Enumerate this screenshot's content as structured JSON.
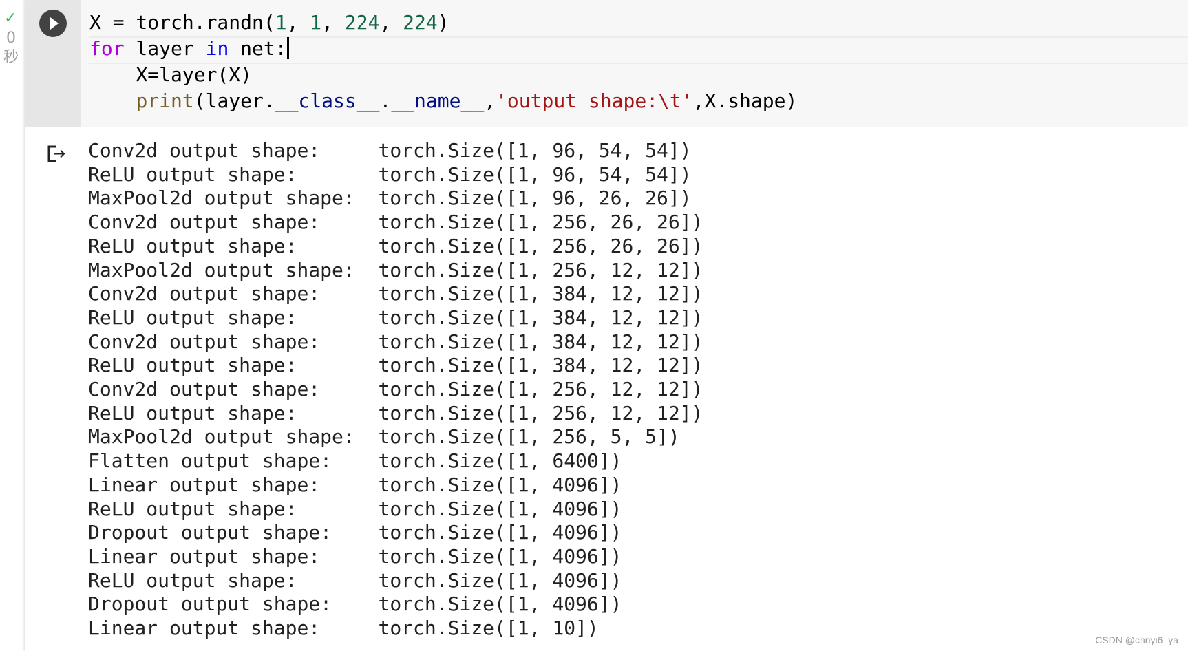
{
  "status": {
    "check_icon": "check-icon",
    "duration_value": "0",
    "duration_unit": "秒"
  },
  "code": {
    "line1": {
      "a": "X = torch.randn(",
      "n1": "1",
      "c1": ", ",
      "n2": "1",
      "c2": ", ",
      "n3": "224",
      "c3": ", ",
      "n4": "224",
      "e": ")"
    },
    "line2": {
      "kw_for": "for",
      "a": " layer ",
      "kw_in": "in",
      "b": " net:"
    },
    "line3": {
      "text": "    X=layer(X)"
    },
    "line4": {
      "indent": "    ",
      "fn": "print",
      "a": "(layer.",
      "attr1": "__class__",
      "dot": ".",
      "attr2": "__name__",
      "comma": ",",
      "str": "'output shape:\\t'",
      "e": ",X.shape)"
    }
  },
  "colors": {
    "number": "#116644",
    "keyword_for": "#af00db",
    "keyword_in": "#0000ff",
    "builtin": "#795e26",
    "attribute": "#001080",
    "string": "#a31515"
  },
  "output": {
    "rows": [
      {
        "layer": "Conv2d",
        "shape": "torch.Size([1, 96, 54, 54])"
      },
      {
        "layer": "ReLU",
        "shape": "torch.Size([1, 96, 54, 54])"
      },
      {
        "layer": "MaxPool2d",
        "shape": "torch.Size([1, 96, 26, 26])"
      },
      {
        "layer": "Conv2d",
        "shape": "torch.Size([1, 256, 26, 26])"
      },
      {
        "layer": "ReLU",
        "shape": "torch.Size([1, 256, 26, 26])"
      },
      {
        "layer": "MaxPool2d",
        "shape": "torch.Size([1, 256, 12, 12])"
      },
      {
        "layer": "Conv2d",
        "shape": "torch.Size([1, 384, 12, 12])"
      },
      {
        "layer": "ReLU",
        "shape": "torch.Size([1, 384, 12, 12])"
      },
      {
        "layer": "Conv2d",
        "shape": "torch.Size([1, 384, 12, 12])"
      },
      {
        "layer": "ReLU",
        "shape": "torch.Size([1, 384, 12, 12])"
      },
      {
        "layer": "Conv2d",
        "shape": "torch.Size([1, 256, 12, 12])"
      },
      {
        "layer": "ReLU",
        "shape": "torch.Size([1, 256, 12, 12])"
      },
      {
        "layer": "MaxPool2d",
        "shape": "torch.Size([1, 256, 5, 5])"
      },
      {
        "layer": "Flatten",
        "shape": "torch.Size([1, 6400])"
      },
      {
        "layer": "Linear",
        "shape": "torch.Size([1, 4096])"
      },
      {
        "layer": "ReLU",
        "shape": "torch.Size([1, 4096])"
      },
      {
        "layer": "Dropout",
        "shape": "torch.Size([1, 4096])"
      },
      {
        "layer": "Linear",
        "shape": "torch.Size([1, 4096])"
      },
      {
        "layer": "ReLU",
        "shape": "torch.Size([1, 4096])"
      },
      {
        "layer": "Dropout",
        "shape": "torch.Size([1, 4096])"
      },
      {
        "layer": "Linear",
        "shape": "torch.Size([1, 10])"
      }
    ],
    "label_suffix": " output shape:"
  },
  "watermark": "CSDN @chnyi6_ya"
}
